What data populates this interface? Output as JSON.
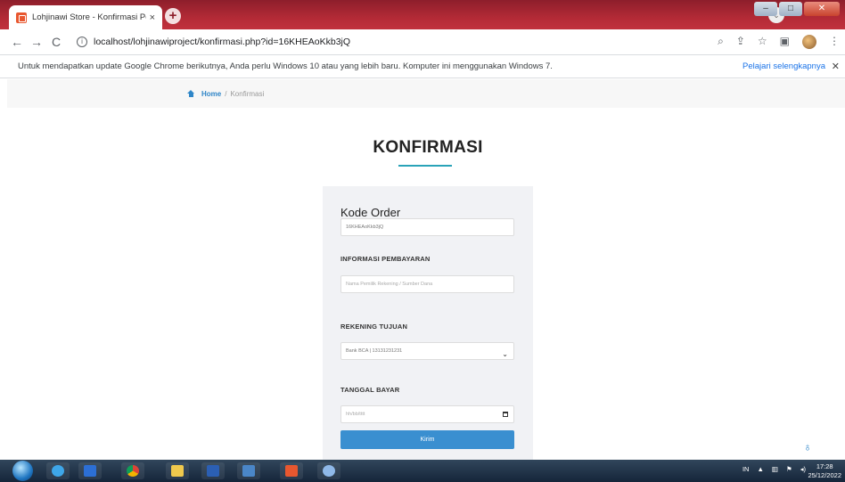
{
  "browser": {
    "tab_title": "Lohjinawi Store - Konfirmasi Pem",
    "tab_close": "×",
    "new_tab": "+",
    "url": "localhost/lohjinawiproject/konfirmasi.php?id=16KHEAoKkb3jQ",
    "win_minimize": "–",
    "win_maximize": "□",
    "win_close": "✕"
  },
  "infobar": {
    "message": "Untuk mendapatkan update Google Chrome berikutnya, Anda perlu Windows 10 atau yang lebih baru. Komputer ini menggunakan Windows 7.",
    "learn_more": "Pelajari selengkapnya",
    "close": "✕"
  },
  "breadcrumb": {
    "home": "Home",
    "separator": "/",
    "current": "Konfirmasi"
  },
  "page": {
    "title": "KONFIRMASI"
  },
  "form": {
    "order_label": "Kode Order",
    "order_value": "16KHEAoKkb3jQ",
    "payment_label": "INFORMASI PEMBAYARAN",
    "payment_placeholder": "Nama Pemilik Rekening / Sumber Dana",
    "account_label": "REKENING TUJUAN",
    "account_selected": "Bank BCA | 13131231231",
    "date_label": "TANGGAL BAYAR",
    "date_placeholder": "hh/bb/tttt",
    "submit_label": "Kirim"
  },
  "taskbar": {
    "lang": "IN",
    "time": "17:28",
    "date": "25/12/2022"
  },
  "colors": {
    "accent": "#3a8fd0",
    "title_underline": "#2aa3b8",
    "breadcrumb_link": "#2f86c8"
  }
}
